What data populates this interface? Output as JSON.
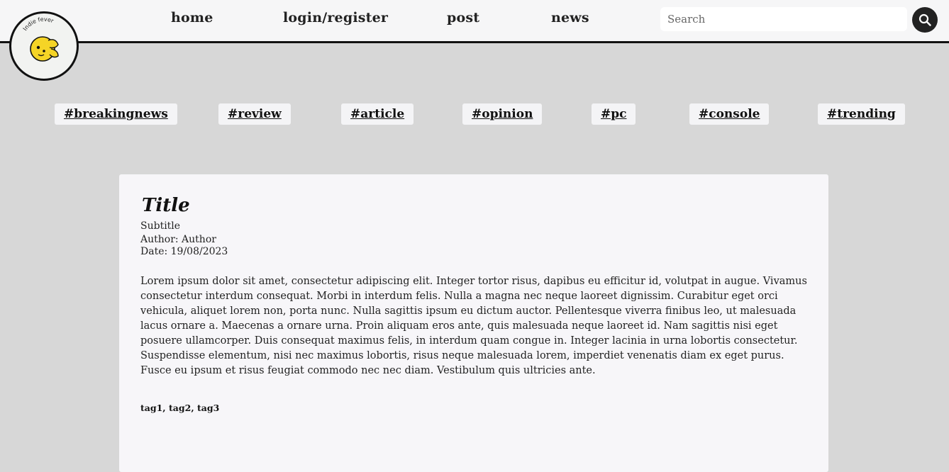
{
  "nav": {
    "links": [
      {
        "label": "home"
      },
      {
        "label": "login/register"
      },
      {
        "label": "post"
      },
      {
        "label": "news"
      }
    ]
  },
  "search": {
    "placeholder": "Search",
    "value": ""
  },
  "logo": {
    "text": "Indie fever",
    "colors": {
      "face": "#f5d426",
      "ring": "#111111"
    }
  },
  "hashtags": [
    "#breakingnews",
    "#review",
    "#article",
    "#opinion",
    "#pc",
    "#console",
    "#trending"
  ],
  "post": {
    "title": "Title",
    "subtitle": "Subtitle",
    "author": "Author: Author",
    "date": "Date: 19/08/2023",
    "body": "Lorem ipsum dolor sit amet, consectetur adipiscing elit. Integer tortor risus, dapibus eu efficitur id, volutpat in augue. Vivamus consectetur interdum consequat. Morbi in interdum felis. Nulla a magna nec neque laoreet dignissim. Curabitur eget orci vehicula, aliquet lorem non, porta nunc. Nulla sagittis ipsum eu dictum auctor. Pellentesque viverra finibus leo, ut malesuada lacus ornare a. Maecenas a ornare urna. Proin aliquam eros ante, quis malesuada neque laoreet id. Nam sagittis nisi eget posuere ullamcorper. Duis consequat maximus felis, in interdum quam congue in. Integer lacinia in urna lobortis consectetur. Suspendisse elementum, nisi nec maximus lobortis, risus neque malesuada lorem, imperdiet venenatis diam ex eget purus. Fusce eu ipsum et risus feugiat commodo nec nec diam. Vestibulum quis ultricies ante.",
    "tags": "tag1, tag2, tag3"
  },
  "colors": {
    "background": "#d7d7d7",
    "topbar": "#f6f6f7",
    "card": "#f7f6f9",
    "accent": "#222222"
  }
}
